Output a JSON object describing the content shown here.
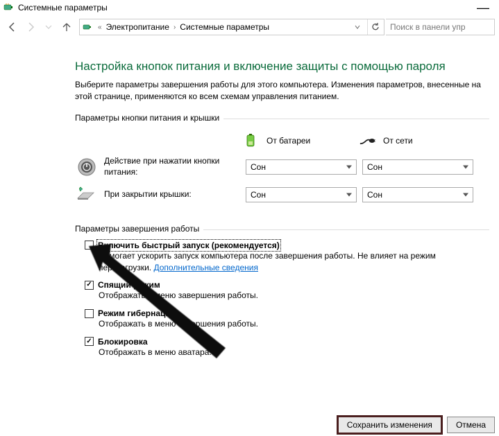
{
  "window_title": "Системные параметры",
  "nav": {
    "crumb1": "Электропитание",
    "crumb2": "Системные параметры",
    "search_placeholder": "Поиск в панели упр"
  },
  "heading": "Настройка кнопок питания и включение защиты с помощью пароля",
  "intro": "Выберите параметры завершения работы для этого компьютера. Изменения параметров, внесенные на этой странице, применяются ко всем схемам управления питанием.",
  "group_power": {
    "title": "Параметры кнопки питания и крышки",
    "battery_label": "От батареи",
    "ac_label": "От сети",
    "row1_label": "Действие при нажатии кнопки питания:",
    "row2_label": "При закрытии крышки:",
    "row1_batt": "Сон",
    "row1_ac": "Сон",
    "row2_batt": "Сон",
    "row2_ac": "Сон"
  },
  "group_shutdown": {
    "title": "Параметры завершения работы",
    "items": [
      {
        "label": "Включить быстрый запуск (рекомендуется)",
        "checked": false,
        "focused": true,
        "desc_prefix": "Помогает ускорить запуск компьютера после завершения работы. Не влияет на режим перезагрузки. ",
        "link": "Дополнительные сведения"
      },
      {
        "label": "Спящий режим",
        "checked": true,
        "focused": false,
        "desc_prefix": "Отображать в меню завершения работы.",
        "link": ""
      },
      {
        "label": "Режим гибернации",
        "checked": false,
        "focused": false,
        "desc_prefix": "Отображать в меню завершения работы.",
        "link": ""
      },
      {
        "label": "Блокировка",
        "checked": true,
        "focused": false,
        "desc_prefix": "Отображать в меню аватара.",
        "link": ""
      }
    ]
  },
  "buttons": {
    "save": "Сохранить изменения",
    "cancel": "Отмена"
  }
}
